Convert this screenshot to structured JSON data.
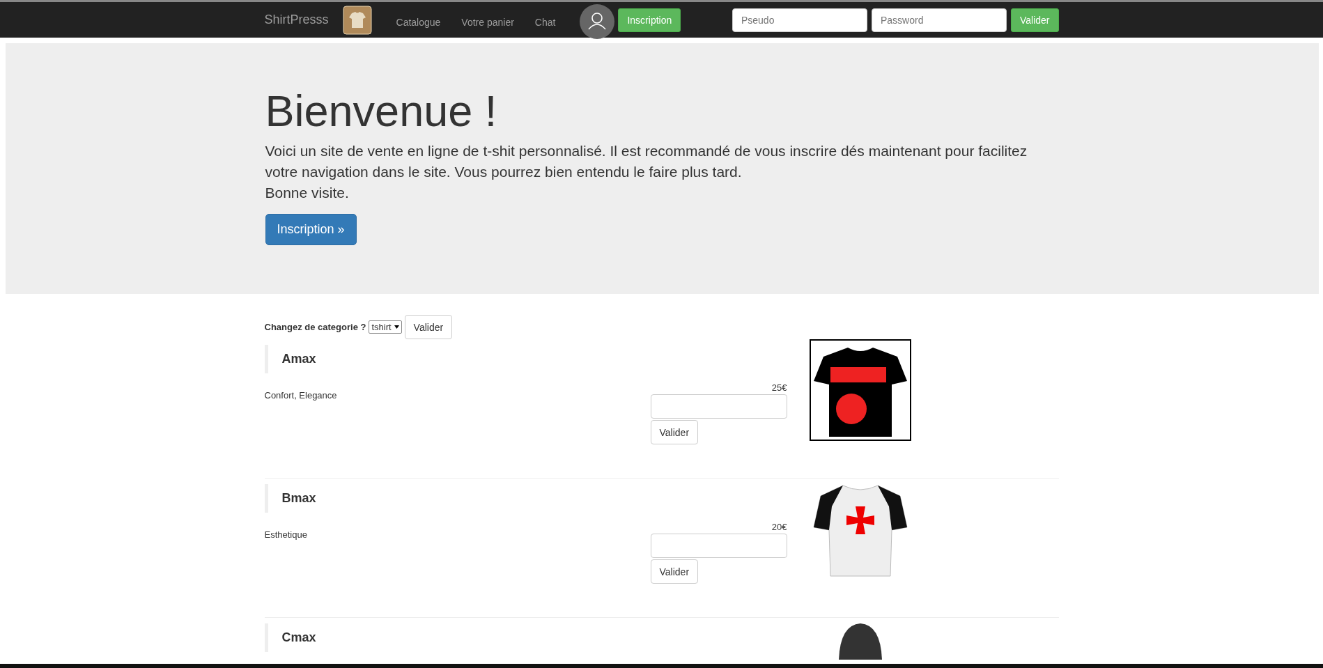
{
  "navbar": {
    "brand": "ShirtPresss",
    "links": [
      "Catalogue",
      "Votre panier",
      "Chat"
    ],
    "signup_button": "Inscription",
    "login": {
      "pseudo_placeholder": "Pseudo",
      "password_placeholder": "Password",
      "submit": "Valider"
    }
  },
  "hero": {
    "title": "Bienvenue !",
    "text": "Voici un site de vente en ligne de t-shit personnalisé. Il est recommandé de vous inscrire dés maintenant pour facilitez votre navigation dans le site. Vous pourrez bien entendu le faire plus tard.",
    "text_2": "Bonne visite.",
    "button": "Inscription »"
  },
  "category_form": {
    "label": "Changez de categorie ?",
    "select_value": "tshirt",
    "submit": "Valider"
  },
  "products": [
    {
      "name": "Amax",
      "description": "Confort, Elegance",
      "price": "25€",
      "submit": "Valider"
    },
    {
      "name": "Bmax",
      "description": "Esthetique",
      "price": "20€",
      "submit": "Valider"
    },
    {
      "name": "Cmax"
    }
  ]
}
